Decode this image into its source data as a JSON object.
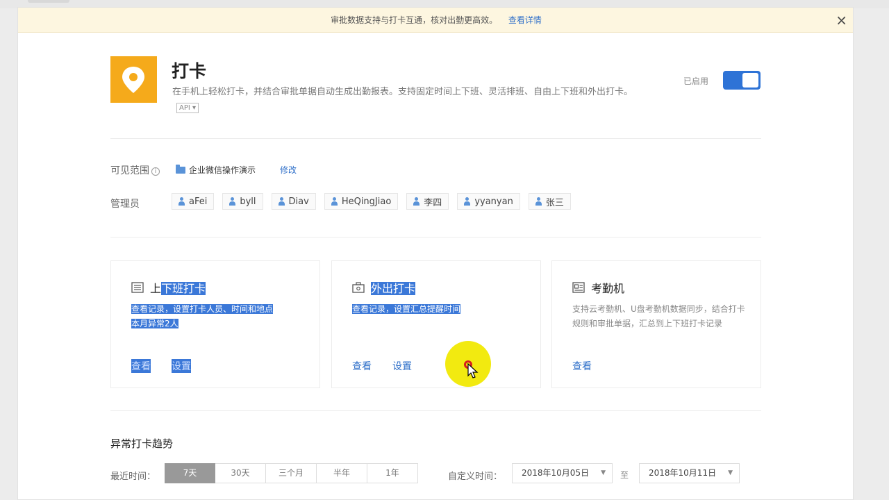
{
  "notice": {
    "text": "审批数据支持与打卡互通，核对出勤更高效。",
    "link": "查看详情",
    "close": "×"
  },
  "app": {
    "title": "打卡",
    "description": "在手机上轻松打卡，并结合审批单据自动生成出勤报表。支持固定时间上下班、灵活排班、自由上下班和外出打卡。",
    "api_tag": "API",
    "status_label": "已启用",
    "enabled": true,
    "icon_color": "#f5aa1b"
  },
  "scope": {
    "label": "可见范围",
    "value": "企业微信操作演示",
    "edit": "修改"
  },
  "admins": {
    "label": "管理员",
    "items": [
      "aFei",
      "byll",
      "Diav",
      "HeQingJiao",
      "李四",
      "yyanyan",
      "张三"
    ]
  },
  "cards": [
    {
      "title_prefix": "上",
      "title_rest": "下班打卡",
      "desc": "查看记录，设置打卡人员、时间和地点",
      "desc2": "本月异常2人",
      "actions": [
        "查看",
        "设置"
      ]
    },
    {
      "title": "外出打卡",
      "desc": "查看记录，设置汇总提醒时间",
      "actions": [
        "查看",
        "设置"
      ]
    },
    {
      "title": "考勤机",
      "desc": "支持云考勤机、U盘考勤机数据同步，结合打卡规则和审批单据，汇总到上下班打卡记录",
      "actions": [
        "查看"
      ]
    }
  ],
  "trend": {
    "title": "异常打卡趋势",
    "time_label": "最近时间：",
    "ranges": [
      "7天",
      "30天",
      "三个月",
      "半年",
      "1年"
    ],
    "active_range": "7天",
    "custom_label": "自定义时间：",
    "start_date": "2018年10月05日",
    "to": "至",
    "end_date": "2018年10月11日"
  }
}
